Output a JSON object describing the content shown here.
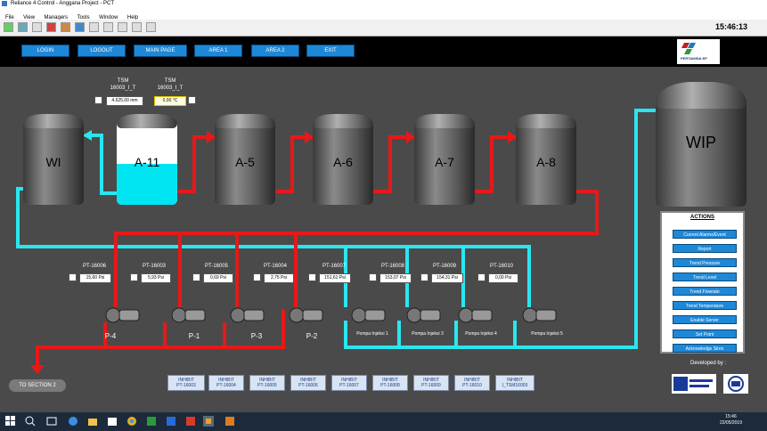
{
  "window": {
    "title": "Reliance 4 Control - Anggana Project - PCT",
    "menu": [
      "File",
      "View",
      "Managers",
      "Tools",
      "Window",
      "Help"
    ],
    "clock": "15:46:13"
  },
  "nav": [
    "LOGIN",
    "LOGOUT",
    "MAIN PAGE",
    "AREA 1",
    "AREA 2",
    "EXIT"
  ],
  "logo": {
    "text": "PERTAMINA EP"
  },
  "tanks": [
    {
      "name": "WI"
    },
    {
      "name": "A-11",
      "fill": 0.5
    },
    {
      "name": "A-5"
    },
    {
      "name": "A-6"
    },
    {
      "name": "A-7"
    },
    {
      "name": "A-8"
    },
    {
      "name": "WIP"
    }
  ],
  "tsm": [
    {
      "tag": "TSM\n16003_I_T",
      "value": "4.625,00 mm"
    },
    {
      "tag": "TSM\n16003_I_T",
      "value": "0,00 °C"
    }
  ],
  "pressure": [
    {
      "tag": "PT-16006",
      "value": "15,60 Psi"
    },
    {
      "tag": "PT-16003",
      "value": "5,93 Psi"
    },
    {
      "tag": "PT-16005",
      "value": "0,69 Psi"
    },
    {
      "tag": "PT-16004",
      "value": "2,75 Psi"
    },
    {
      "tag": "PT-16007",
      "value": "151,61 Psi"
    },
    {
      "tag": "PT-16008",
      "value": "153,07 Psi"
    },
    {
      "tag": "PT-16009",
      "value": "154,31 Psi"
    },
    {
      "tag": "PT-16010",
      "value": "0,00 Psi"
    }
  ],
  "pumps": [
    {
      "label": "P-4"
    },
    {
      "label": "P-1"
    },
    {
      "label": "P-3"
    },
    {
      "label": "P-2"
    },
    {
      "label": "Pompa Injeksi 1"
    },
    {
      "label": "Pompa Injeksi 3"
    },
    {
      "label": "Pompa Injeksi 4"
    },
    {
      "label": "Pompa Injeksi 5"
    }
  ],
  "actions": {
    "title": "ACTIONS",
    "buttons": [
      "Current Alarms/Event",
      "Report",
      "Trend Pressure",
      "Trend Level",
      "Trend Flowrate",
      "Trend Temperature",
      "Enable Server",
      "Set Point",
      "Acknowledge Siren"
    ]
  },
  "developed_by": "Developed by :",
  "inhibit": [
    {
      "line1": "INHIBIT",
      "line2": "PT-16003"
    },
    {
      "line1": "INHIBIT",
      "line2": "PT-16004"
    },
    {
      "line1": "INHIBIT",
      "line2": "PT-16005"
    },
    {
      "line1": "INHIBIT",
      "line2": "PT-16006"
    },
    {
      "line1": "INHIBIT",
      "line2": "PT-16007"
    },
    {
      "line1": "INHIBIT",
      "line2": "PT-16008"
    },
    {
      "line1": "INHIBIT",
      "line2": "PT-16009"
    },
    {
      "line1": "INHIBIT",
      "line2": "PT-16010"
    },
    {
      "line1": "INHIBIT",
      "line2": "I_TSM16003"
    }
  ],
  "to_section": "TO SECTION 2",
  "taskbar": {
    "time": "15:46",
    "date": "22/05/2019"
  },
  "colors": {
    "water": "#29e6f0",
    "oil": "#e81818",
    "button": "#1e88d8",
    "background": "#4a4a4a"
  }
}
